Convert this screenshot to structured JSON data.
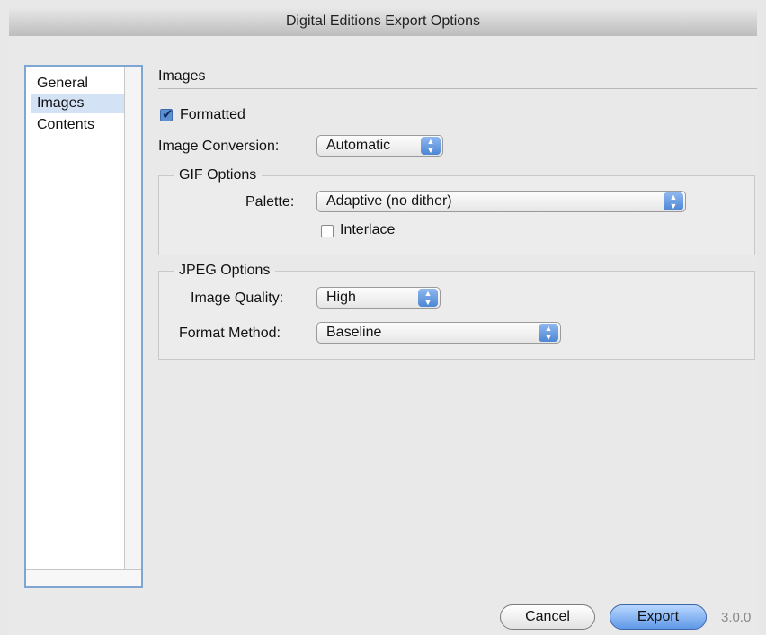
{
  "window": {
    "title": "Digital Editions Export Options"
  },
  "sidebar": {
    "items": [
      {
        "label": "General",
        "selected": false
      },
      {
        "label": "Images",
        "selected": true
      },
      {
        "label": "Contents",
        "selected": false
      }
    ]
  },
  "images": {
    "section_title": "Images",
    "formatted": {
      "label": "Formatted",
      "checked": true
    },
    "image_conversion": {
      "label": "Image Conversion:",
      "value": "Automatic"
    }
  },
  "gif_options": {
    "title": "GIF Options",
    "palette": {
      "label": "Palette:",
      "value": "Adaptive (no dither)"
    },
    "interlace": {
      "label": "Interlace",
      "checked": false
    }
  },
  "jpeg_options": {
    "title": "JPEG Options",
    "image_quality": {
      "label": "Image Quality:",
      "value": "High"
    },
    "format_method": {
      "label": "Format Method:",
      "value": "Baseline"
    }
  },
  "footer": {
    "cancel_label": "Cancel",
    "export_label": "Export",
    "version": "3.0.0"
  },
  "colors": {
    "accent": "#5e8fd0",
    "selection": "#d4e2f6"
  }
}
